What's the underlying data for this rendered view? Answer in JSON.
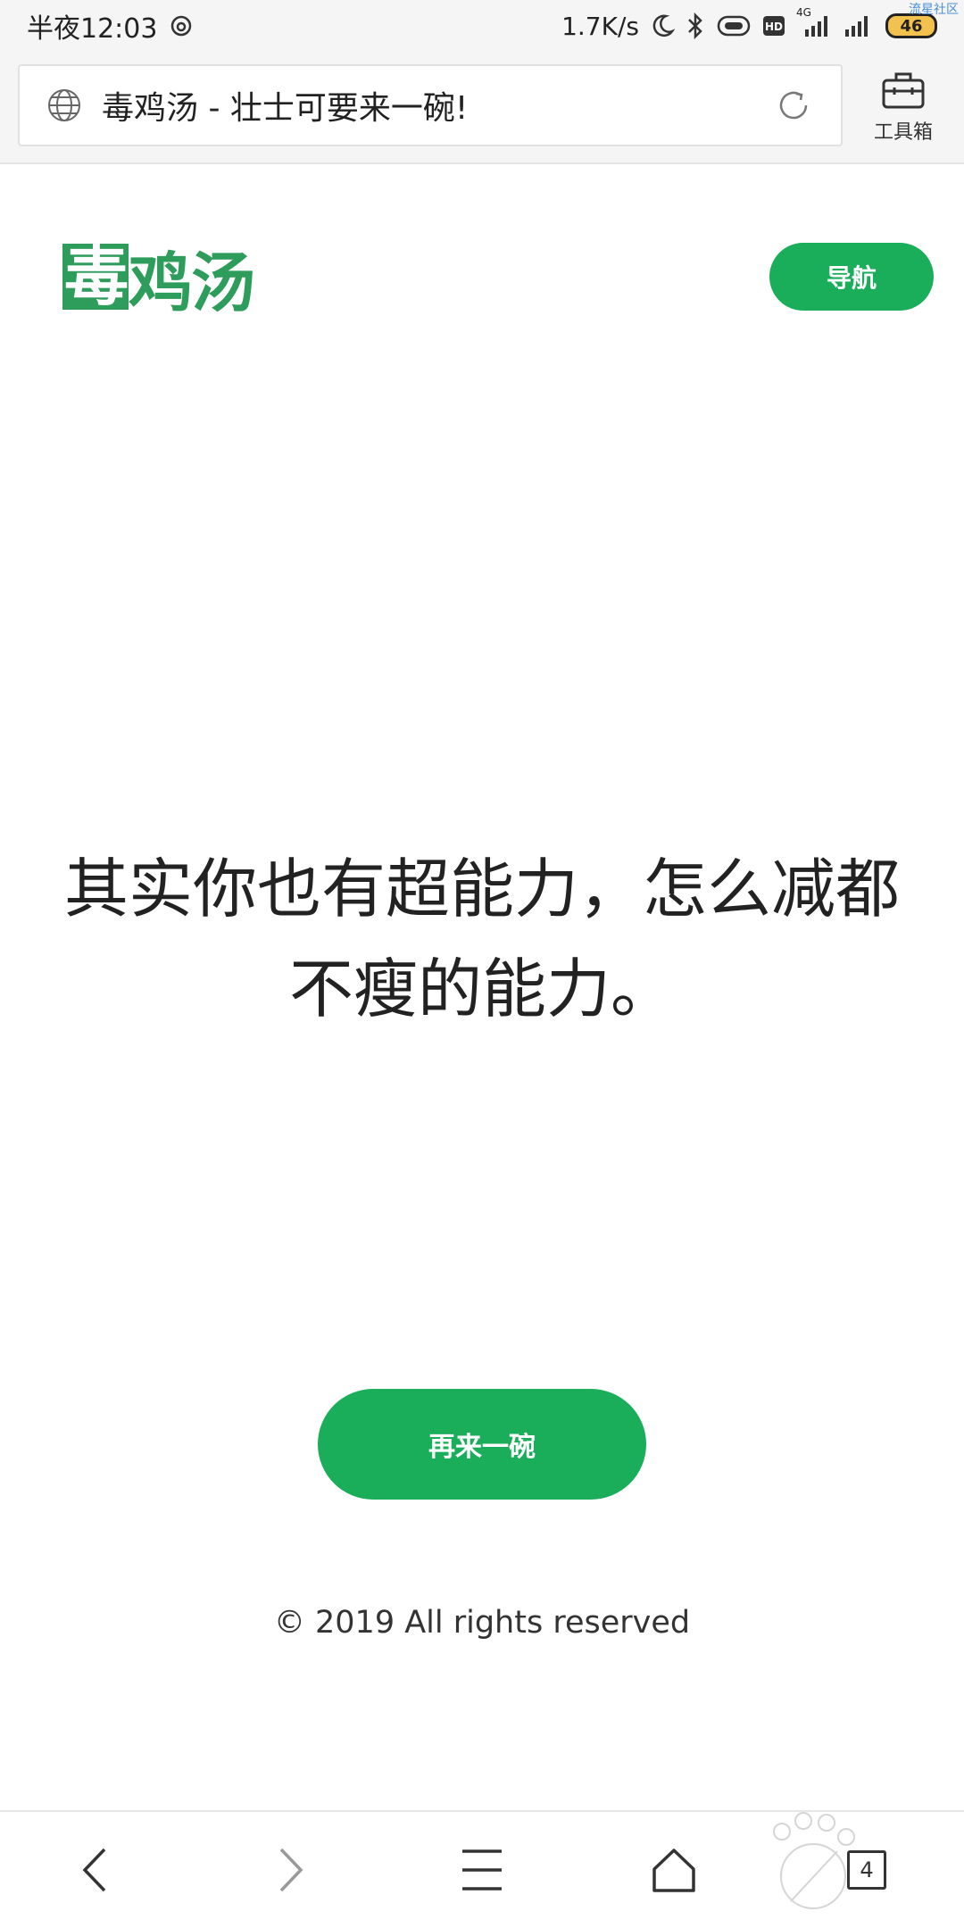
{
  "status_bar": {
    "time": "半夜12:03",
    "network_speed": "1.7K/s",
    "network_type": "4G",
    "battery": "46",
    "watermark": "流星社区",
    "icons": [
      "netease-music-icon",
      "moon-icon",
      "bluetooth-icon",
      "vibrate-icon",
      "hd-icon",
      "signal-icon",
      "signal-icon-2",
      "battery-icon"
    ],
    "battery_color": "#f2c14e"
  },
  "browser": {
    "page_title": "毒鸡汤 - 壮士可要来一碗!",
    "toolbox_label": "工具箱",
    "icons": [
      "globe-icon",
      "reload-icon",
      "toolbox-icon"
    ]
  },
  "site": {
    "logo_first": "毒",
    "logo_rest": "鸡汤",
    "nav_label": "导航",
    "quote": "其实你也有超能力，怎么减都不瘦的能力。",
    "again_label": "再来一碗",
    "copyright": "© 2019 All rights reserved",
    "accent_color": "#1aad5a",
    "logo_color": "#2e9d5b"
  },
  "bottom_nav": {
    "tab_count": "4",
    "icons": [
      "back-icon",
      "forward-icon",
      "menu-icon",
      "home-icon",
      "tabs-icon"
    ]
  }
}
